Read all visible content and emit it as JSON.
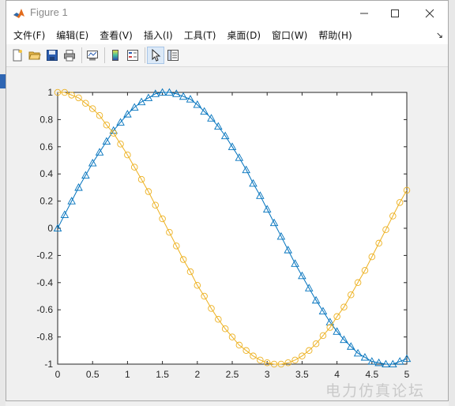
{
  "window": {
    "title": "Figure 1"
  },
  "titlebar_controls": {
    "minimize_icon": "minimize-icon",
    "maximize_icon": "maximize-icon",
    "close_icon": "close-icon"
  },
  "menu": {
    "items": [
      "文件(F)",
      "编辑(E)",
      "查看(V)",
      "插入(I)",
      "工具(T)",
      "桌面(D)",
      "窗口(W)",
      "帮助(H)"
    ],
    "overflow_icon": "menu-overflow-arrow-icon"
  },
  "toolbar": {
    "icons": [
      "new-figure-icon",
      "open-file-icon",
      "save-icon",
      "print-icon",
      "link-plot-icon",
      "colorbar-icon",
      "legend-icon",
      "edit-plot-pointer-icon",
      "property-inspector-icon"
    ],
    "selected": "edit-plot-pointer-icon"
  },
  "watermark": "电力仿真论坛",
  "chart_data": {
    "type": "line",
    "title": "",
    "xlabel": "",
    "ylabel": "",
    "xlim": [
      0,
      5
    ],
    "ylim": [
      -1,
      1
    ],
    "xticks": [
      "0",
      "0.5",
      "1",
      "1.5",
      "2",
      "2.5",
      "3",
      "3.5",
      "4",
      "4.5",
      "5"
    ],
    "yticks": [
      "-1",
      "-0.8",
      "-0.6",
      "-0.4",
      "-0.2",
      "0",
      "0.2",
      "0.4",
      "0.6",
      "0.8",
      "1"
    ],
    "grid": false,
    "box": true,
    "x": [
      0,
      0.1,
      0.2,
      0.3,
      0.4,
      0.5,
      0.6,
      0.7,
      0.8,
      0.9,
      1.0,
      1.1,
      1.2,
      1.3,
      1.4,
      1.5,
      1.6,
      1.7,
      1.8,
      1.9,
      2.0,
      2.1,
      2.2,
      2.3,
      2.4,
      2.5,
      2.6,
      2.7,
      2.8,
      2.9,
      3.0,
      3.1,
      3.2,
      3.3,
      3.4,
      3.5,
      3.6,
      3.7,
      3.8,
      3.9,
      4.0,
      4.1,
      4.2,
      4.3,
      4.4,
      4.5,
      4.6,
      4.7,
      4.8,
      4.9,
      5.0
    ],
    "series": [
      {
        "color": "#0072bd",
        "marker": "triangle",
        "values": [
          0,
          0.1,
          0.2,
          0.3,
          0.39,
          0.48,
          0.56,
          0.64,
          0.72,
          0.78,
          0.84,
          0.89,
          0.93,
          0.96,
          0.99,
          1.0,
          1.0,
          0.99,
          0.97,
          0.95,
          0.91,
          0.86,
          0.81,
          0.75,
          0.68,
          0.6,
          0.52,
          0.43,
          0.33,
          0.24,
          0.14,
          0.04,
          -0.06,
          -0.16,
          -0.26,
          -0.35,
          -0.44,
          -0.53,
          -0.61,
          -0.69,
          -0.76,
          -0.82,
          -0.87,
          -0.92,
          -0.95,
          -0.98,
          -0.99,
          -1.0,
          -1.0,
          -0.98,
          -0.96
        ]
      },
      {
        "color": "#edb120",
        "marker": "circle",
        "values": [
          1.0,
          1.0,
          0.98,
          0.96,
          0.92,
          0.88,
          0.83,
          0.76,
          0.7,
          0.62,
          0.54,
          0.45,
          0.36,
          0.27,
          0.17,
          0.07,
          -0.03,
          -0.13,
          -0.23,
          -0.32,
          -0.42,
          -0.5,
          -0.59,
          -0.67,
          -0.74,
          -0.8,
          -0.86,
          -0.9,
          -0.94,
          -0.97,
          -0.99,
          -1.0,
          -1.0,
          -0.99,
          -0.97,
          -0.94,
          -0.9,
          -0.85,
          -0.79,
          -0.73,
          -0.65,
          -0.58,
          -0.49,
          -0.4,
          -0.31,
          -0.21,
          -0.11,
          -0.01,
          0.09,
          0.19,
          0.28
        ]
      }
    ]
  }
}
